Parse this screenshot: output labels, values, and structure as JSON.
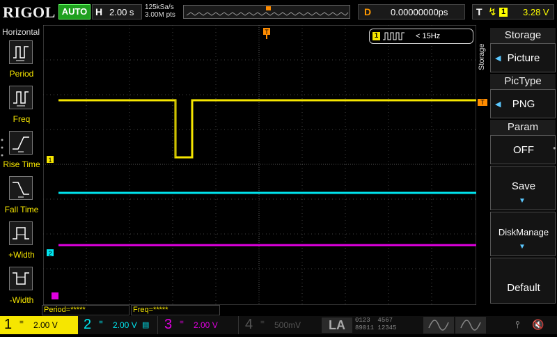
{
  "brand": "RIGOL",
  "run_mode": "AUTO",
  "horizontal": {
    "key": "H",
    "timebase": "2.00 s",
    "sample_rate": "125kSa/s",
    "mem_depth": "3.00M pts"
  },
  "delay": {
    "key": "D",
    "value": "0.00000000ps"
  },
  "trigger": {
    "key": "T",
    "channel": "1",
    "level": "3.28 V",
    "marker": "T"
  },
  "measure_badge": {
    "channel": "1",
    "text": "< 15Hz"
  },
  "left_panel": {
    "title": "Horizontal",
    "items": [
      {
        "label": "Period",
        "icon": "period-icon"
      },
      {
        "label": "Freq",
        "icon": "freq-icon"
      },
      {
        "label": "Rise Time",
        "icon": "rise-time-icon"
      },
      {
        "label": "Fall Time",
        "icon": "fall-time-icon"
      },
      {
        "label": "+Width",
        "icon": "pos-width-icon"
      },
      {
        "label": "-Width",
        "icon": "neg-width-icon"
      }
    ]
  },
  "right_panel": {
    "side_label": "Storage",
    "storage": {
      "title": "Storage",
      "value": "Picture"
    },
    "pictype": {
      "title": "PicType",
      "value": "PNG"
    },
    "param": {
      "title": "Param",
      "value": "OFF"
    },
    "save": {
      "label": "Save"
    },
    "diskmanage": {
      "label": "DiskManage"
    },
    "default": {
      "label": "Default"
    }
  },
  "waveform_markers": {
    "ch1": "1",
    "ch2": "2",
    "trig_level": "T"
  },
  "measurements": {
    "period": "Period=*****",
    "freq": "Freq=*****"
  },
  "channels": [
    {
      "num": "1",
      "coupling": "=",
      "scale": "2.00 V",
      "color": "#f6e600"
    },
    {
      "num": "2",
      "coupling": "=",
      "scale": "2.00 V",
      "color": "#00e6f0"
    },
    {
      "num": "3",
      "coupling": "=",
      "scale": "2.00 V",
      "color": "#e000e0"
    },
    {
      "num": "4",
      "coupling": "=",
      "scale": "500mV",
      "color": "#3a6ad0"
    }
  ],
  "logic_analyzer": {
    "label": "LA",
    "groups_top": [
      "0123",
      "4567"
    ],
    "groups_bottom": [
      "89011",
      "12345"
    ]
  },
  "colors": {
    "ch1": "#f6e600",
    "ch2": "#00e6f0",
    "ch3": "#e000e0",
    "ch4": "#3a6ad0",
    "accent": "#ff8c00",
    "grid": "#555555"
  }
}
